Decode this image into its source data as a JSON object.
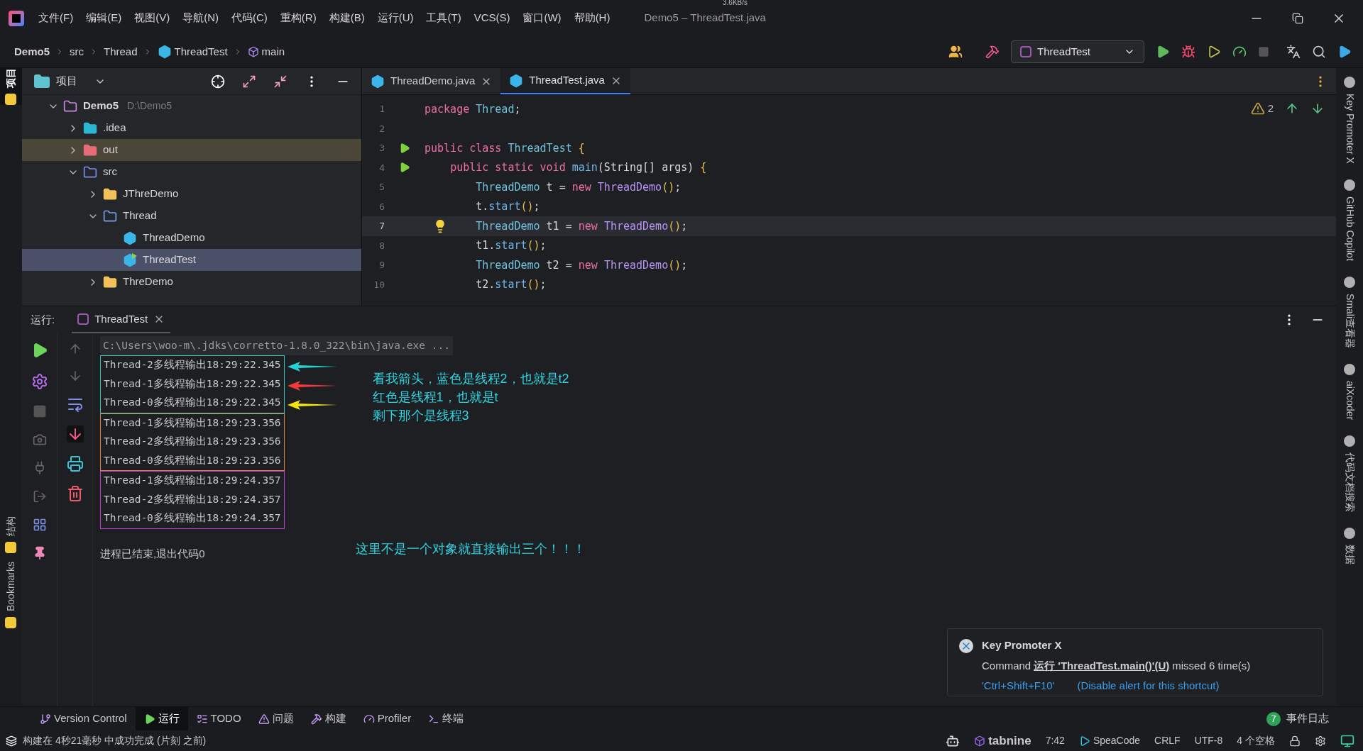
{
  "window": {
    "title": "Demo5 – ThreadTest.java",
    "net_speed": "3.6KB/s"
  },
  "menu": [
    "文件(F)",
    "编辑(E)",
    "视图(V)",
    "导航(N)",
    "代码(C)",
    "重构(R)",
    "构建(B)",
    "运行(U)",
    "工具(T)",
    "VCS(S)",
    "窗口(W)",
    "帮助(H)"
  ],
  "breadcrumb": [
    {
      "label": "Demo5",
      "kind": "text"
    },
    {
      "label": "src",
      "kind": "text"
    },
    {
      "label": "Thread",
      "kind": "text"
    },
    {
      "label": "ThreadTest",
      "kind": "class"
    },
    {
      "label": "main",
      "kind": "method"
    }
  ],
  "run_config": {
    "label": "ThreadTest"
  },
  "left_strip": [
    {
      "label": "项目",
      "selected": true
    },
    {
      "label": "结构",
      "selected": false
    },
    {
      "label": "Bookmarks",
      "selected": false
    }
  ],
  "project": {
    "title": "项目",
    "tree": [
      {
        "label": "Demo5",
        "hint": "D:\\Demo5",
        "kind": "module",
        "expanded": true,
        "selected": false,
        "children": [
          {
            "label": ".idea",
            "kind": "idea",
            "expanded": false,
            "selected": false
          },
          {
            "label": "out",
            "kind": "excluded",
            "expanded": false,
            "selected": false
          },
          {
            "label": "src",
            "kind": "source",
            "expanded": true,
            "selected": false,
            "children": [
              {
                "label": "JThreDemo",
                "kind": "package",
                "expanded": false,
                "selected": false
              },
              {
                "label": "Thread",
                "kind": "folder",
                "expanded": true,
                "selected": false,
                "children": [
                  {
                    "label": "ThreadDemo",
                    "kind": "class",
                    "selected": false
                  },
                  {
                    "label": "ThreadTest",
                    "kind": "main-class",
                    "selected": true
                  }
                ]
              },
              {
                "label": "ThreDemo",
                "kind": "package",
                "expanded": false,
                "selected": false
              }
            ]
          }
        ]
      }
    ]
  },
  "editor": {
    "tabs": [
      {
        "label": "ThreadDemo.java",
        "selected": false
      },
      {
        "label": "ThreadTest.java",
        "selected": true
      }
    ],
    "warnings": "2",
    "lines": [
      {
        "number": "1",
        "runnable": false,
        "bulb": false,
        "tokens": [
          {
            "text": "package ",
            "kind": "keyword"
          },
          {
            "text": "Thread",
            "kind": "type"
          },
          {
            "text": ";",
            "kind": "plain"
          }
        ]
      },
      {
        "number": "2",
        "runnable": false,
        "bulb": false
      },
      {
        "number": "3",
        "runnable": true,
        "bulb": false,
        "tokens": [
          {
            "text": "public class ",
            "kind": "keyword"
          },
          {
            "text": "ThreadTest",
            "kind": "type"
          },
          {
            "text": " {",
            "kind": "brace"
          }
        ]
      },
      {
        "number": "4",
        "runnable": true,
        "bulb": false,
        "tokens": [
          {
            "text": "    public static void ",
            "kind": "keyword"
          },
          {
            "text": "main",
            "kind": "method"
          },
          {
            "text": "(String[] args) ",
            "kind": "plain"
          },
          {
            "text": "{",
            "kind": "brace"
          }
        ]
      },
      {
        "number": "5",
        "runnable": false,
        "bulb": false,
        "tokens": [
          {
            "text": "        ThreadDemo",
            "kind": "type"
          },
          {
            "text": " t = ",
            "kind": "plain"
          },
          {
            "text": "new ",
            "kind": "keyword"
          },
          {
            "text": "ThreadDemo",
            "kind": "classref"
          },
          {
            "text": "()",
            "kind": "brace"
          },
          {
            "text": ";",
            "kind": "plain"
          }
        ]
      },
      {
        "number": "6",
        "runnable": false,
        "bulb": false,
        "tokens": [
          {
            "text": "        t.",
            "kind": "plain"
          },
          {
            "text": "start",
            "kind": "method"
          },
          {
            "text": "()",
            "kind": "brace"
          },
          {
            "text": ";",
            "kind": "plain"
          }
        ]
      },
      {
        "number": "7",
        "runnable": false,
        "bulb": true,
        "current": true,
        "tokens": [
          {
            "text": "        ThreadDemo",
            "kind": "type"
          },
          {
            "text": " t1 = ",
            "kind": "plain"
          },
          {
            "text": "new ",
            "kind": "keyword"
          },
          {
            "text": "ThreadDemo",
            "kind": "classref"
          },
          {
            "text": "()",
            "kind": "brace"
          },
          {
            "text": ";",
            "kind": "plain"
          }
        ]
      },
      {
        "number": "8",
        "runnable": false,
        "bulb": false,
        "tokens": [
          {
            "text": "        t1.",
            "kind": "plain"
          },
          {
            "text": "start",
            "kind": "method"
          },
          {
            "text": "()",
            "kind": "brace"
          },
          {
            "text": ";",
            "kind": "plain"
          }
        ]
      },
      {
        "number": "9",
        "runnable": false,
        "bulb": false,
        "tokens": [
          {
            "text": "        ThreadDemo",
            "kind": "type"
          },
          {
            "text": " t2 = ",
            "kind": "plain"
          },
          {
            "text": "new ",
            "kind": "keyword"
          },
          {
            "text": "ThreadDemo",
            "kind": "classref"
          },
          {
            "text": "()",
            "kind": "brace"
          },
          {
            "text": ";",
            "kind": "plain"
          }
        ]
      },
      {
        "number": "10",
        "runnable": false,
        "bulb": false,
        "tokens": [
          {
            "text": "        t2.",
            "kind": "plain"
          },
          {
            "text": "start",
            "kind": "method"
          },
          {
            "text": "()",
            "kind": "brace"
          },
          {
            "text": ";",
            "kind": "plain"
          }
        ]
      }
    ]
  },
  "run": {
    "label": "运行:",
    "tab": "ThreadTest",
    "command": "C:\\Users\\woo-m\\.jdks\\corretto-1.8.0_322\\bin\\java.exe ...",
    "groups": [
      {
        "color": "#2ec4c4",
        "lines": [
          "Thread-2多线程输出18:29:22.345",
          "Thread-1多线程输出18:29:22.345",
          "Thread-0多线程输出18:29:22.345"
        ]
      },
      {
        "color": "#e0822e",
        "lines": [
          "Thread-1多线程输出18:29:23.356",
          "Thread-2多线程输出18:29:23.356",
          "Thread-0多线程输出18:29:23.356"
        ]
      },
      {
        "color": "#c73ad6",
        "lines": [
          "Thread-1多线程输出18:29:24.357",
          "Thread-2多线程输出18:29:24.357",
          "Thread-0多线程输出18:29:24.357"
        ]
      }
    ],
    "arrows": [
      {
        "color": "#22d3d3"
      },
      {
        "color": "#ef3b3b"
      },
      {
        "color": "#f5e50c"
      }
    ],
    "exit": "进程已结束,退出代码0",
    "note": [
      "看我箭头，蓝色是线程2，也就是t2",
      "红色是线程1，也就是t",
      "剩下那个是线程3"
    ],
    "note2": "这里不是一个对象就直接输出三个！！！"
  },
  "right_strip": [
    "Key Promoter X",
    "GitHub Copilot",
    "Smali查看器",
    "aiXcoder",
    "代码文档搜索",
    "数据"
  ],
  "notification": {
    "title": "Key Promoter X",
    "text_before": "Command",
    "link": "运行 'ThreadTest.main()'(U)",
    "text_after": "missed 6 time(s)",
    "shortcut": "'Ctrl+Shift+F10'",
    "disable": "(Disable alert for this shortcut)"
  },
  "bottom_tabs": [
    {
      "label": "Version Control",
      "kind": "vcs",
      "selected": false
    },
    {
      "label": "运行",
      "kind": "run",
      "selected": true
    },
    {
      "label": "TODO",
      "kind": "todo",
      "selected": false
    },
    {
      "label": "问题",
      "kind": "problems",
      "selected": false
    },
    {
      "label": "构建",
      "kind": "build",
      "selected": false
    },
    {
      "label": "Profiler",
      "kind": "profiler",
      "selected": false
    },
    {
      "label": "终端",
      "kind": "terminal",
      "selected": false
    }
  ],
  "event_log": {
    "count": "7",
    "label": "事件日志"
  },
  "status_bar": {
    "message": "构建在 4秒21毫秒 中成功完成 (片刻 之前)",
    "items": [
      "tabnine",
      "7:42",
      "SpeaCode",
      "CRLF",
      "UTF-8",
      "4 个空格"
    ]
  }
}
